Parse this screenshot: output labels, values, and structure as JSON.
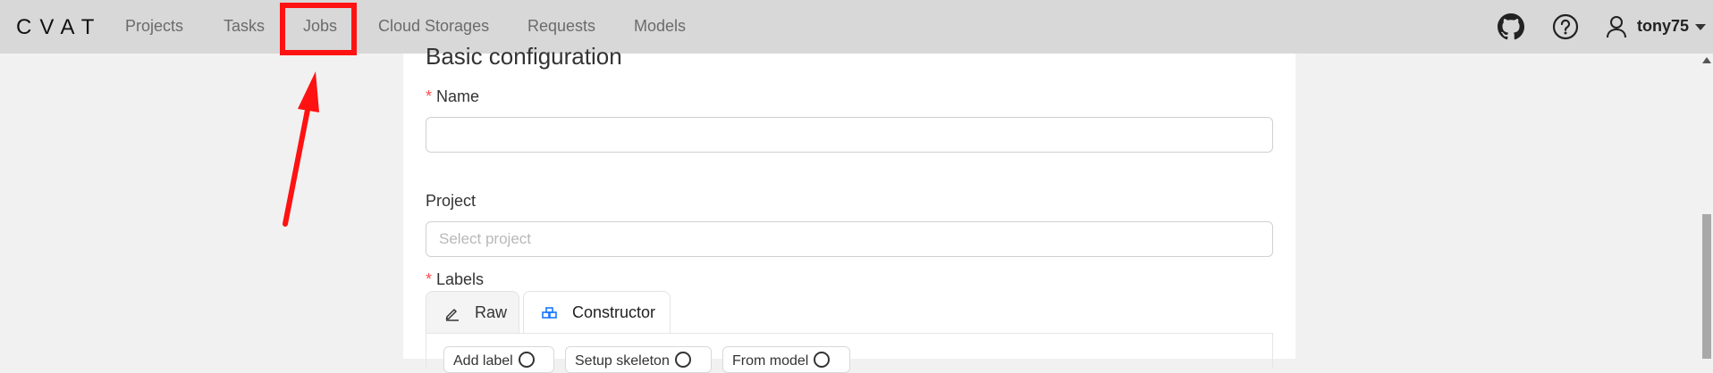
{
  "header": {
    "logo": "CVAT",
    "nav": [
      "Projects",
      "Tasks",
      "Jobs",
      "Cloud Storages",
      "Requests",
      "Models"
    ],
    "highlighted_nav": "Jobs",
    "username": "tony75"
  },
  "form": {
    "section_title": "Basic configuration",
    "name_label": "Name",
    "name_value": "",
    "project_label": "Project",
    "project_placeholder": "Select project",
    "labels_label": "Labels",
    "required_mark": "*",
    "tabs": [
      "Raw",
      "Constructor"
    ],
    "active_tab": "Constructor",
    "chips": [
      "Add label",
      "Setup skeleton",
      "From model"
    ]
  },
  "colors": {
    "header_bg": "#d8d8d8",
    "highlight": "#ff1212",
    "required": "#ff4d4f",
    "constructor_icon": "#1677ff"
  },
  "icons": [
    "github-icon",
    "help-icon",
    "user-icon",
    "caret-down-icon",
    "edit-icon",
    "constructor-icon"
  ]
}
